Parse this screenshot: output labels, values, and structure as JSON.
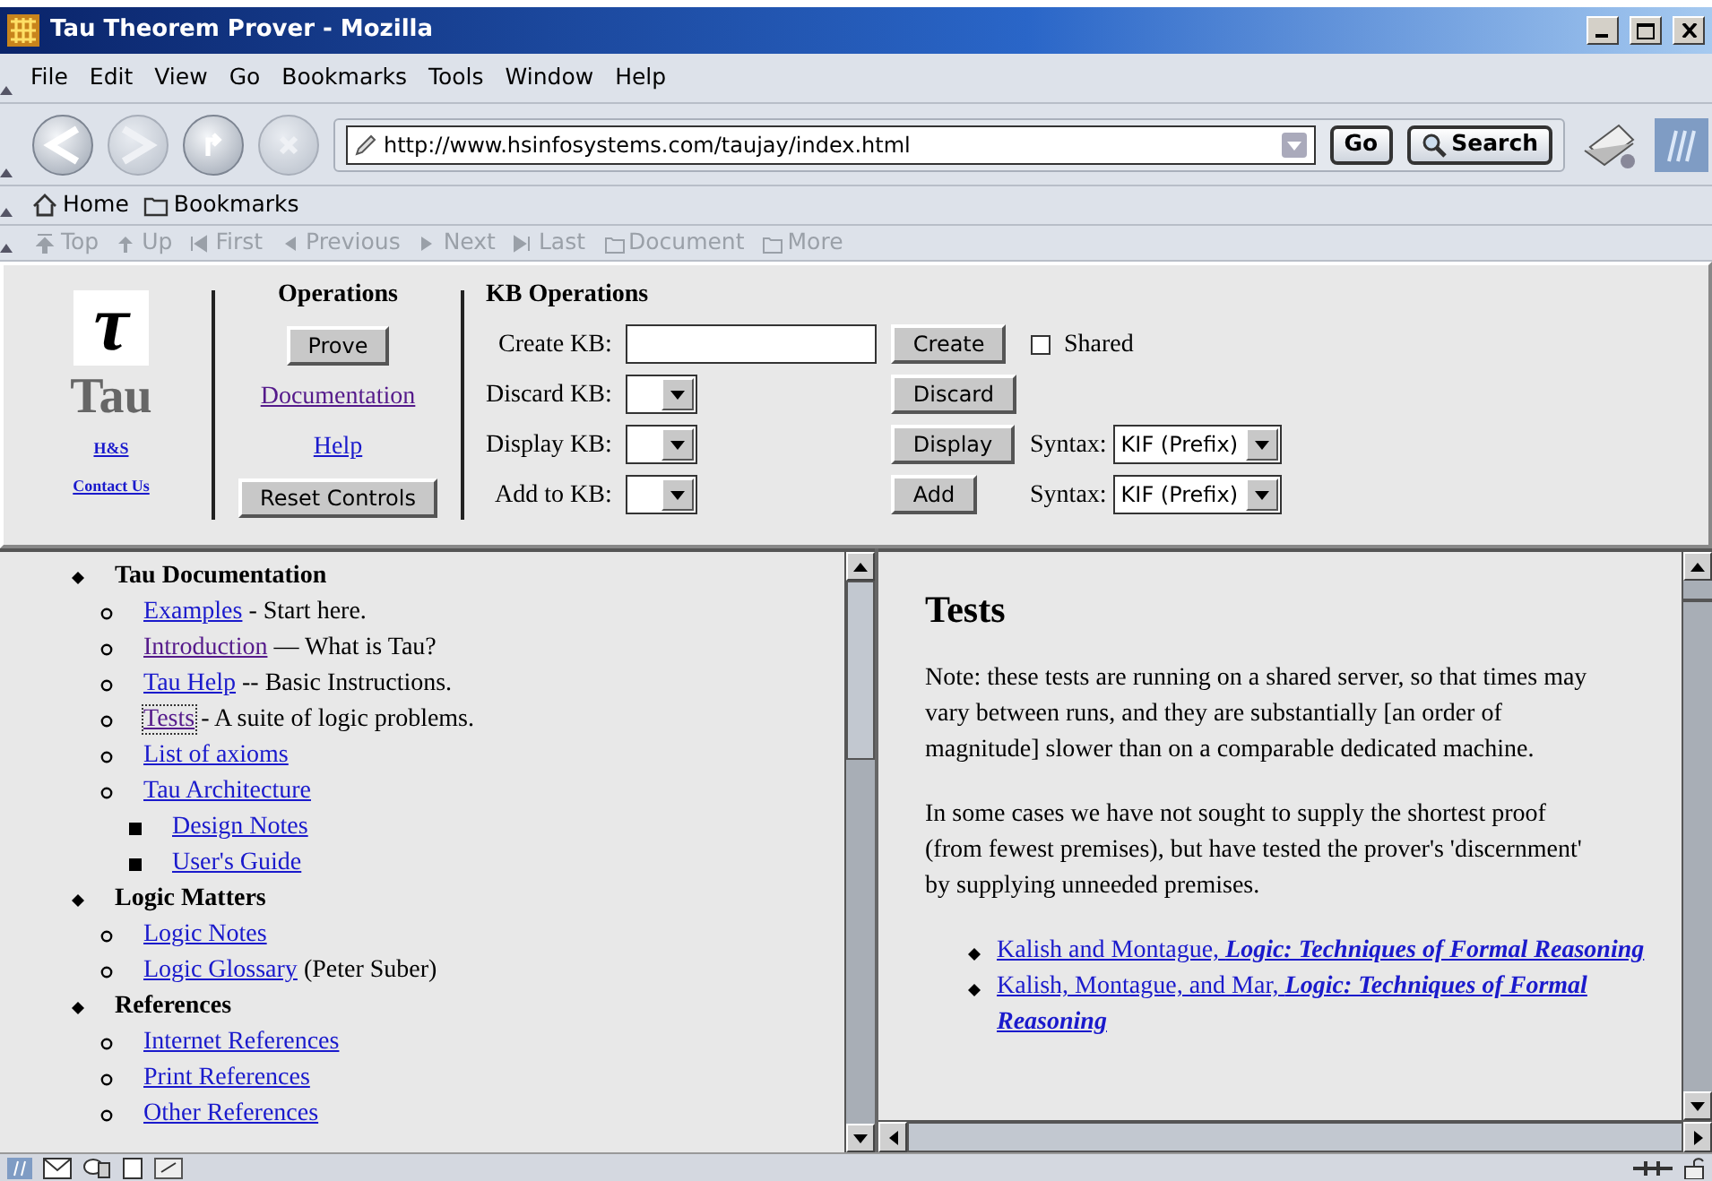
{
  "window": {
    "title": "Tau Theorem Prover - Mozilla"
  },
  "menu": [
    "File",
    "Edit",
    "View",
    "Go",
    "Bookmarks",
    "Tools",
    "Window",
    "Help"
  ],
  "navigation": {
    "buttons": [
      {
        "kind": "back",
        "disabled": false
      },
      {
        "kind": "forward",
        "disabled": true
      },
      {
        "kind": "reload",
        "disabled": false
      },
      {
        "kind": "stop",
        "disabled": true
      }
    ],
    "url": "http://www.hsinfosystems.com/taujay/index.html",
    "go": "Go",
    "search": "Search"
  },
  "personal_toolbar": [
    {
      "kind": "home",
      "label": "Home"
    },
    {
      "kind": "folder",
      "label": "Bookmarks"
    }
  ],
  "site_navigation": [
    {
      "kind": "top",
      "label": "Top",
      "disabled": true
    },
    {
      "kind": "up",
      "label": "Up",
      "disabled": true
    },
    {
      "kind": "first",
      "label": "First",
      "disabled": true
    },
    {
      "kind": "previous",
      "label": "Previous",
      "disabled": true
    },
    {
      "kind": "next",
      "label": "Next",
      "disabled": true
    },
    {
      "kind": "last",
      "label": "Last",
      "disabled": true
    },
    {
      "kind": "folder",
      "label": "Document",
      "disabled": true
    },
    {
      "kind": "folder",
      "label": "More",
      "disabled": true
    }
  ],
  "form": {
    "logo": {
      "symbol": "τ",
      "name": "Tau",
      "links": [
        "H&S",
        "Contact Us"
      ]
    },
    "operations": {
      "title": "Operations",
      "items": [
        {
          "kind": "button",
          "label": "Prove"
        },
        {
          "kind": "link",
          "label": "Documentation",
          "visited": true
        },
        {
          "kind": "link",
          "label": "Help",
          "visited": false
        },
        {
          "kind": "button",
          "label": "Reset Controls"
        }
      ]
    },
    "kb": {
      "title": "KB Operations",
      "rows": [
        {
          "label": "Create KB:",
          "kind": "text",
          "button": "Create",
          "extra": {
            "kind": "checkbox",
            "label": "Shared",
            "checked": false
          }
        },
        {
          "label": "Discard KB:",
          "kind": "select",
          "button": "Discard"
        },
        {
          "label": "Display KB:",
          "kind": "select",
          "button": "Display",
          "extra": {
            "kind": "select",
            "label": "Syntax:",
            "value": "KIF (Prefix)"
          }
        },
        {
          "label": "Add to KB:",
          "kind": "select",
          "button": "Add",
          "extra": {
            "kind": "select",
            "label": "Syntax:",
            "value": "KIF (Prefix)"
          }
        }
      ]
    }
  },
  "left_frame": {
    "items": [
      {
        "text": "Tau Documentation",
        "children": [
          {
            "link": "Examples",
            "visited": false,
            "focused": false,
            "note": "- Start here."
          },
          {
            "link": "Introduction",
            "visited": true,
            "focused": false,
            "note": "— What is Tau?"
          },
          {
            "link": "Tau Help",
            "visited": false,
            "focused": false,
            "note": "-- Basic Instructions."
          },
          {
            "link": "Tests",
            "visited": true,
            "focused": true,
            "note": "- A suite of logic problems."
          },
          {
            "link": "List of axioms",
            "visited": false,
            "focused": false
          },
          {
            "link": "Tau Architecture",
            "visited": false,
            "focused": false,
            "children": [
              {
                "link": "Design Notes",
                "visited": false,
                "focused": false
              },
              {
                "link": "User's Guide",
                "visited": false,
                "focused": false
              }
            ]
          }
        ]
      },
      {
        "text": "Logic Matters",
        "children": [
          {
            "link": "Logic Notes",
            "visited": false,
            "focused": false
          },
          {
            "link": "Logic Glossary",
            "visited": false,
            "focused": false,
            "note": "(Peter Suber)"
          }
        ]
      },
      {
        "text": "References",
        "children": [
          {
            "link": "Internet References",
            "visited": false,
            "focused": false
          },
          {
            "link": "Print References",
            "visited": false,
            "focused": false
          },
          {
            "link": "Other References",
            "visited": false,
            "focused": false
          }
        ]
      }
    ]
  },
  "right_frame": {
    "heading": "Tests",
    "paragraphs": [
      "Note: these tests are running on a shared server, so that times may vary between runs, and they are substantially [an order of magnitude] slower than on a comparable dedicated machine.",
      "In some cases we have not sought to supply the shortest proof (from fewest premises), but have tested the prover's 'discernment' by supplying unneeded premises."
    ],
    "references": [
      {
        "author": "Kalish and Montague,",
        "title": "Logic: Techniques of Formal Reasoning"
      },
      {
        "author": "Kalish, Montague, and Mar,",
        "title": "Logic: Techniques of Formal Reasoning"
      }
    ]
  }
}
